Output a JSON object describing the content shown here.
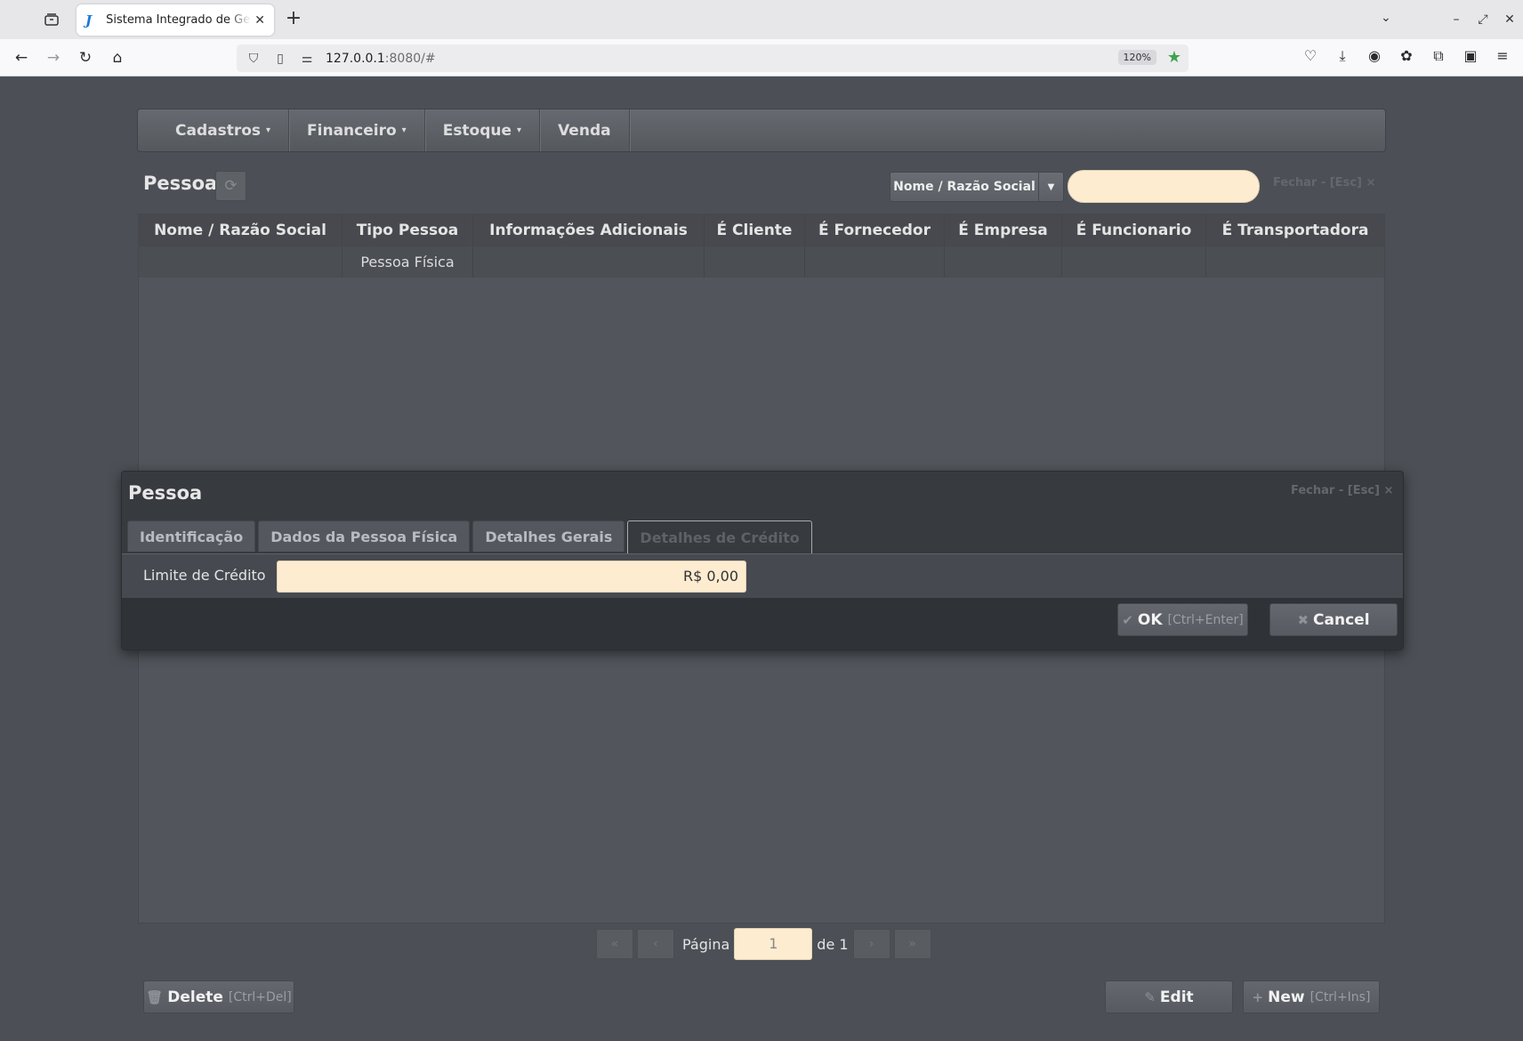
{
  "browser": {
    "tab_title": "Sistema Integrado de Gestão",
    "tab_favicon": "J",
    "url_host": "127.0.0.1",
    "url_rest": ":8080/#",
    "zoom": "120%"
  },
  "menu": {
    "items": [
      {
        "label": "Cadastros",
        "caret": "▾"
      },
      {
        "label": "Financeiro",
        "caret": "▾"
      },
      {
        "label": "Estoque",
        "caret": "▾"
      },
      {
        "label": "Venda",
        "caret": ""
      }
    ]
  },
  "list": {
    "title": "Pessoa",
    "filter_label": "Nome / Razão Social",
    "close_label": "Fechar - [Esc] ×",
    "columns": [
      "Nome / Razão Social",
      "Tipo Pessoa",
      "Informações Adicionais",
      "É Cliente",
      "É Fornecedor",
      "É Empresa",
      "É Funcionario",
      "É Transportadora"
    ],
    "rows": [
      [
        "",
        "Pessoa Física",
        "",
        "",
        "",
        "",
        "",
        ""
      ]
    ]
  },
  "pager": {
    "page_label": "Página",
    "page_value": "1",
    "of_label": "de 1"
  },
  "actions": {
    "delete_label": "Delete",
    "delete_hint": "[Ctrl+Del]",
    "edit_label": "Edit",
    "new_label": "New",
    "new_hint": "[Ctrl+Ins]"
  },
  "modal": {
    "title": "Pessoa",
    "close_label": "Fechar - [Esc] ×",
    "tabs": [
      "Identificação",
      "Dados da Pessoa Física",
      "Detalhes Gerais",
      "Detalhes de Crédito"
    ],
    "active_tab": "Detalhes de Crédito",
    "field_label": "Limite de Crédito",
    "field_value": "R$ 0,00",
    "ok_label": "OK",
    "ok_hint": "[Ctrl+Enter]",
    "cancel_label": "Cancel"
  }
}
